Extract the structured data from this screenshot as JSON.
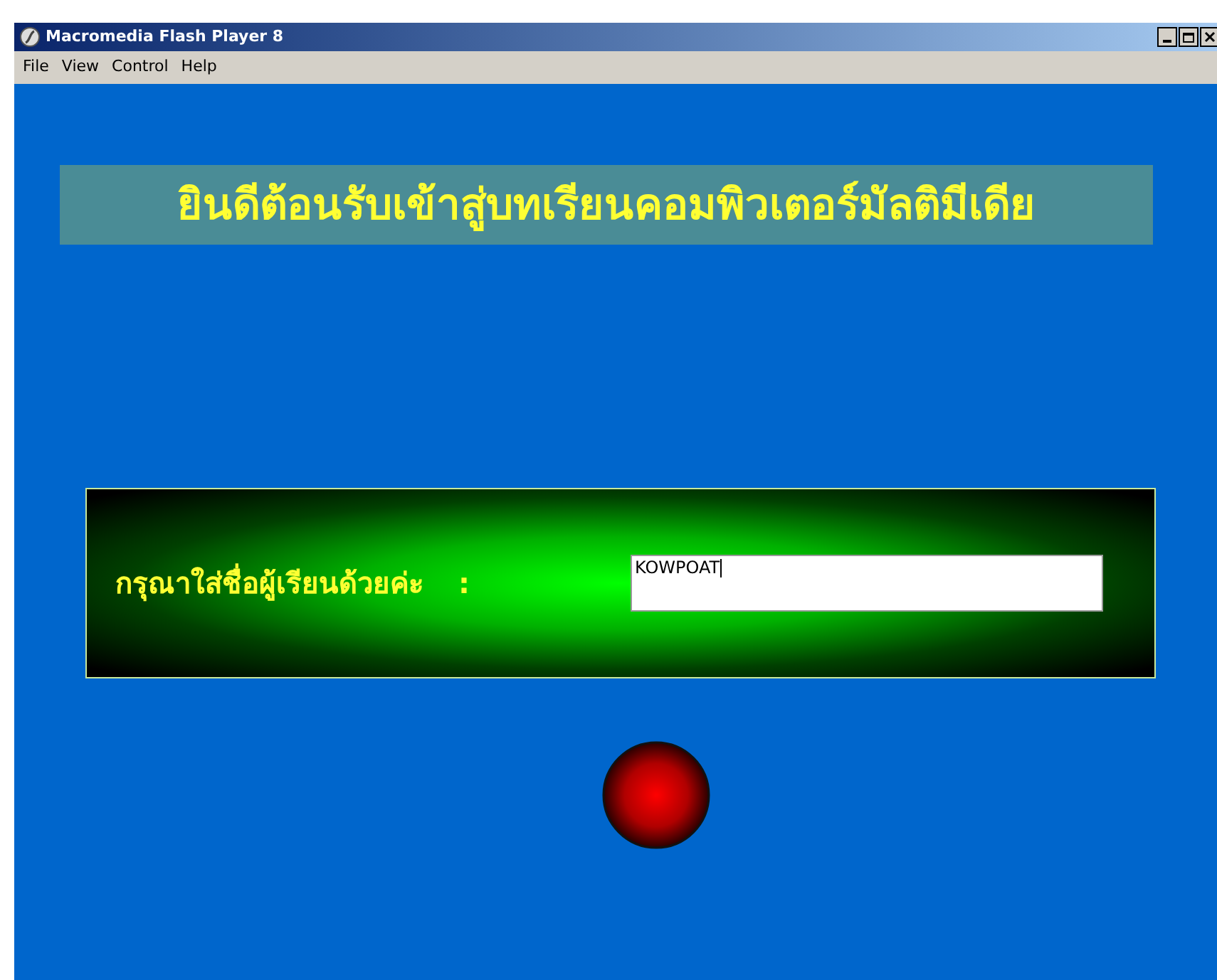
{
  "window": {
    "title": "Macromedia Flash Player 8"
  },
  "menu": [
    "File",
    "View",
    "Control",
    "Help"
  ],
  "banner": {
    "title": "ยินดีต้อนรับเข้าสู่บทเรียนคอมพิวเตอร์มัลติมีเดีย"
  },
  "name_panel": {
    "label": "กรุณาใส่ชื่อผู้เรียนด้วยค่ะ",
    "separator": ":",
    "field": {
      "value": "KOWPOAT"
    }
  }
}
